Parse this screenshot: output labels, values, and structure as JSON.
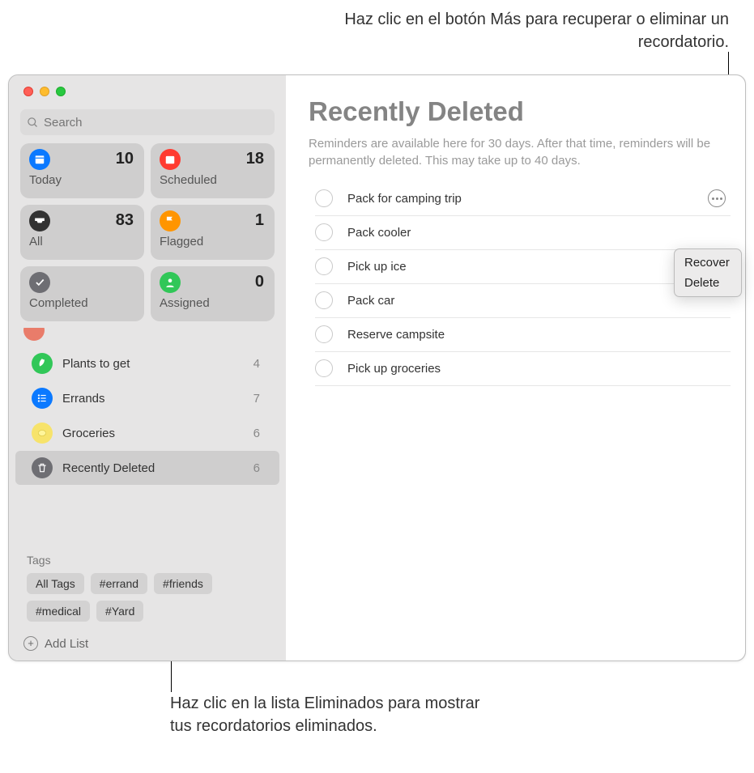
{
  "callouts": {
    "top": "Haz clic en el botón Más para recuperar o eliminar un recordatorio.",
    "bottom": "Haz clic en la lista Eliminados para mostrar tus recordatorios eliminados."
  },
  "search": {
    "placeholder": "Search"
  },
  "cards": [
    {
      "label": "Today",
      "count": 10,
      "bg": "#0b79ff"
    },
    {
      "label": "Scheduled",
      "count": 18,
      "bg": "#ff3b30"
    },
    {
      "label": "All",
      "count": 83,
      "bg": "#323232"
    },
    {
      "label": "Flagged",
      "count": 1,
      "bg": "#ff9500"
    },
    {
      "label": "Completed",
      "count": "",
      "bg": "#6e6e73"
    },
    {
      "label": "Assigned",
      "count": 0,
      "bg": "#31c758"
    }
  ],
  "lists": [
    {
      "name": "Plants to get",
      "count": 4,
      "icon_bg": "#31c758"
    },
    {
      "name": "Errands",
      "count": 7,
      "icon_bg": "#0b79ff"
    },
    {
      "name": "Groceries",
      "count": 6,
      "icon_bg": "#f7e36b"
    },
    {
      "name": "Recently Deleted",
      "count": 6,
      "icon_bg": "#6e6e73",
      "selected": true
    }
  ],
  "tags": {
    "heading": "Tags",
    "items": [
      "All Tags",
      "#errand",
      "#friends",
      "#medical",
      "#Yard"
    ]
  },
  "addlist_label": "Add List",
  "main": {
    "title": "Recently Deleted",
    "subtitle": "Reminders are available here for 30 days. After that time, reminders will be permanently deleted. This may take up to 40 days.",
    "reminders": [
      "Pack for camping trip",
      "Pack cooler",
      "Pick up ice",
      "Pack car",
      "Reserve campsite",
      "Pick up groceries"
    ],
    "menu": {
      "recover": "Recover",
      "delete": "Delete"
    }
  }
}
